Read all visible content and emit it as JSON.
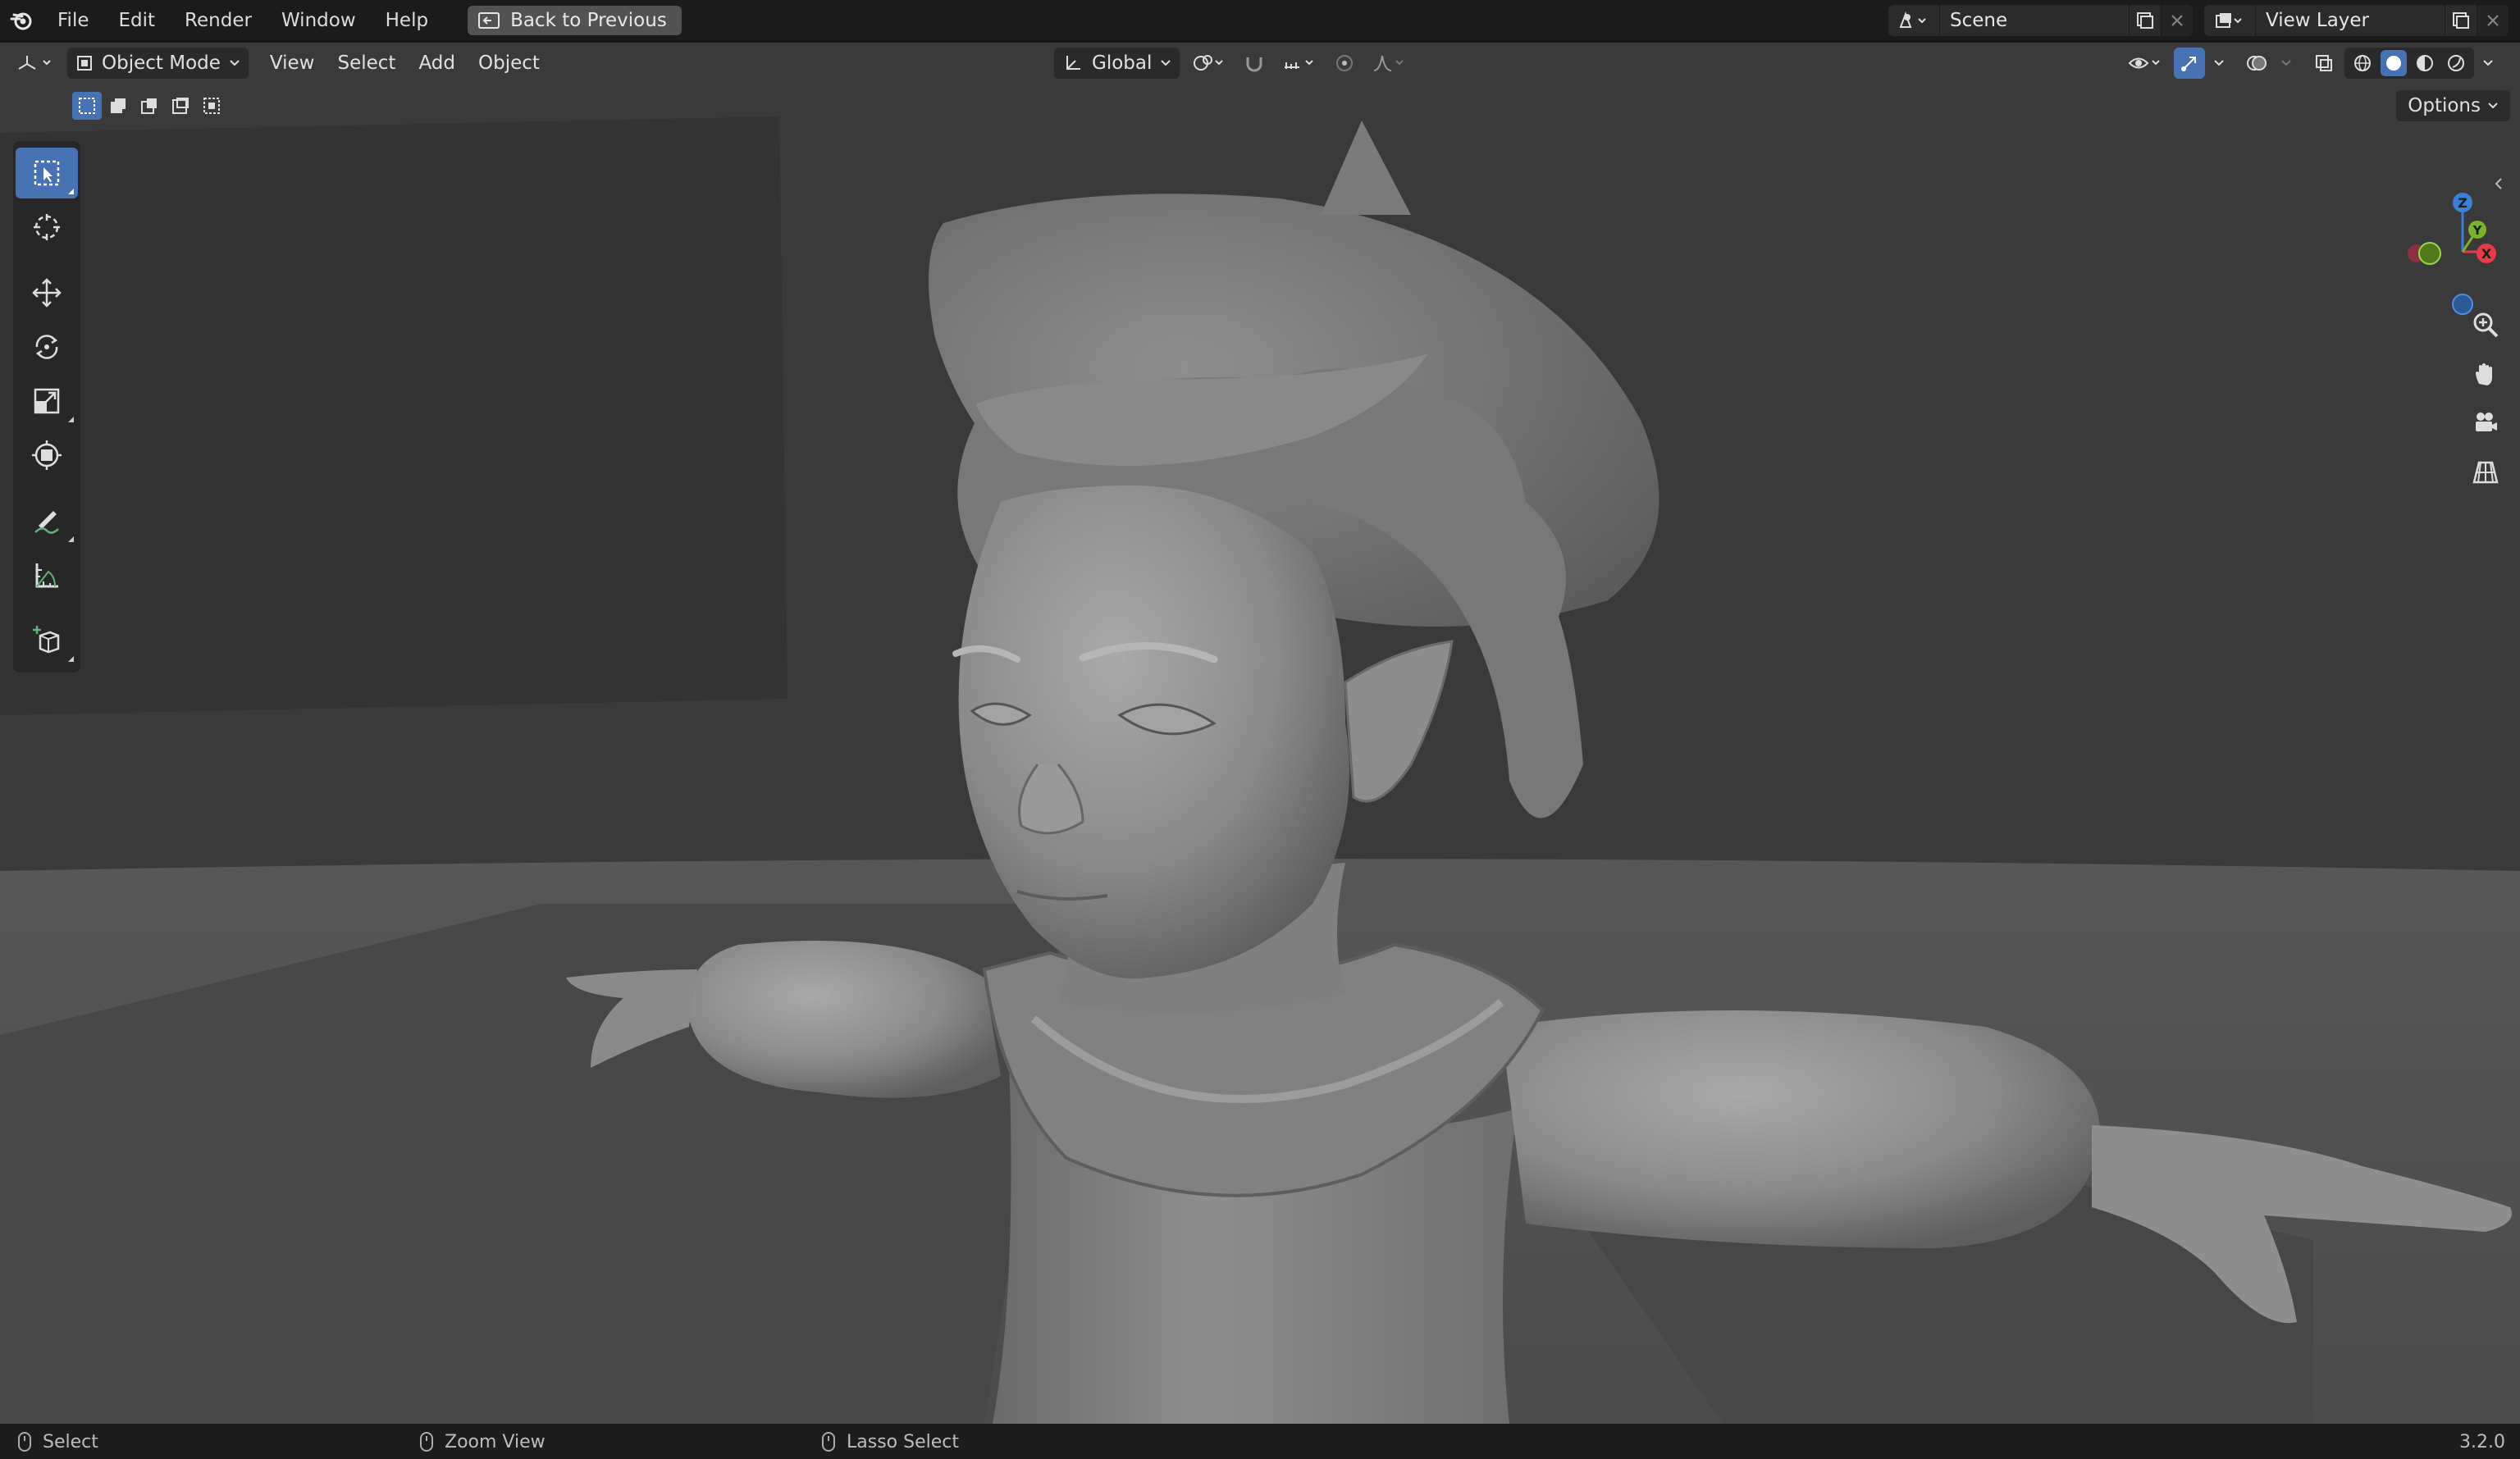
{
  "app": {
    "menu": [
      "File",
      "Edit",
      "Render",
      "Window",
      "Help"
    ],
    "back_button": "Back to Previous",
    "scene_name": "Scene",
    "view_layer_name": "View Layer"
  },
  "viewport": {
    "mode": "Object Mode",
    "menus": [
      "View",
      "Select",
      "Add",
      "Object"
    ],
    "transform_orientation": "Global",
    "options_label": "Options",
    "gizmo_axes": {
      "z": "Z",
      "y": "Y",
      "x": "X"
    },
    "colors": {
      "x_axis": "#e63a4a",
      "y_axis": "#7ab32a",
      "z_axis": "#3c7fd6",
      "active_tool": "#4772b3"
    },
    "tools": [
      "select-box-icon",
      "cursor-icon",
      "move-icon",
      "rotate-icon",
      "scale-icon",
      "transform-icon",
      "annotate-icon",
      "measure-icon",
      "add-cube-icon"
    ]
  },
  "statusbar": {
    "left_action": "Select",
    "middle_action": "Zoom View",
    "right_action": "Lasso Select",
    "version": "3.2.0"
  }
}
